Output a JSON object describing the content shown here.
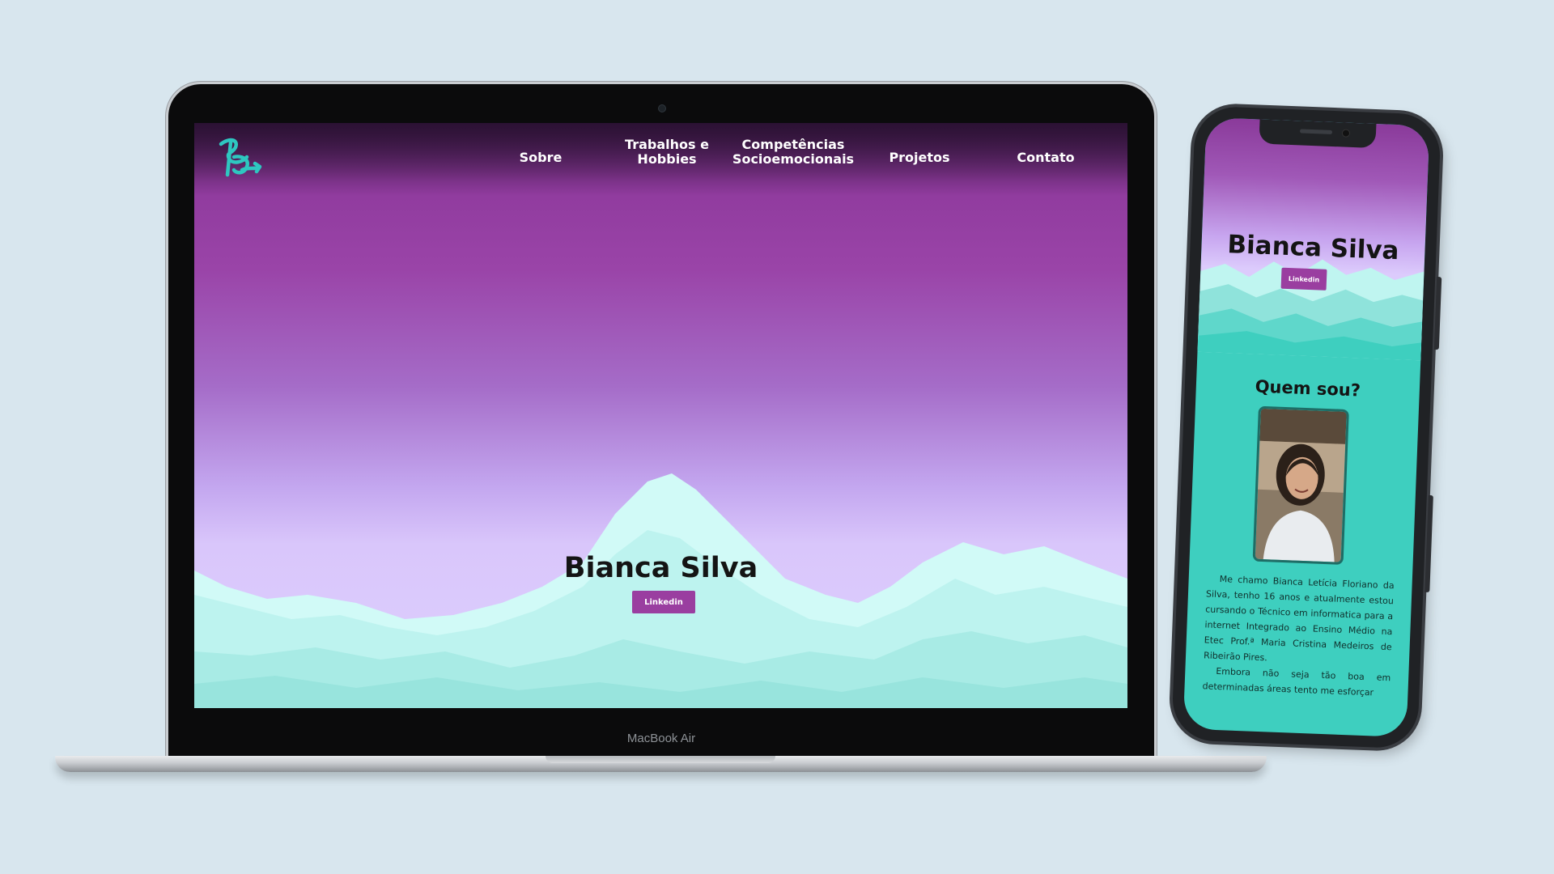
{
  "laptop": {
    "device_label": "MacBook Air",
    "site": {
      "nav": [
        {
          "lines": [
            "Sobre"
          ]
        },
        {
          "lines": [
            "Trabalhos e",
            "Hobbies"
          ]
        },
        {
          "lines": [
            "Competências",
            "Socioemocionais"
          ]
        },
        {
          "lines": [
            "Projetos"
          ]
        },
        {
          "lines": [
            "Contato"
          ]
        }
      ],
      "hero": {
        "name": "Bianca Silva",
        "button_label": "Linkedin"
      }
    }
  },
  "phone": {
    "hero": {
      "name": "Bianca Silva",
      "button_label": "Linkedin"
    },
    "about": {
      "heading": "Quem sou?",
      "paragraphs": [
        "Me chamo Bianca Letícia Floriano da Silva, tenho 16 anos e atualmente estou cursando o Técnico em informatica para a internet Integrado ao Ensino Médio na Etec Prof.ª Maria Cristina Medeiros de Ribeirão Pires.",
        "Embora não seja tão boa em determinadas áreas tento me esforçar"
      ]
    }
  },
  "colors": {
    "background": "#d8e6ee",
    "nav_dark": "#4a1e54",
    "sky_purple": "#9a44a8",
    "sky_lavender": "#d9c6fb",
    "mountain_mint": "#bff5f0",
    "teal": "#3ecfbf",
    "button_purple": "#9a3ea0",
    "logo_teal": "#2ec7c0"
  },
  "icons": {
    "logo": "bs-monogram-logo",
    "portrait": "profile-photo"
  }
}
